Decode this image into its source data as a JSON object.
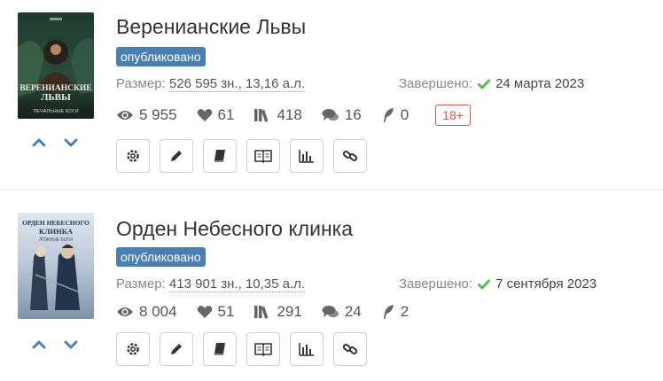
{
  "colors": {
    "accent": "#4a7fb2",
    "check": "#5cb85c",
    "age_badge": "#d9534f"
  },
  "books": [
    {
      "title": "Веренианские Львы",
      "status": "опубликовано",
      "size_label": "Размер:",
      "size_value": "526 595 зн., 13,16 а.л.",
      "finished_label": "Завершено:",
      "finished_date": "24 марта 2023",
      "stats": {
        "views": "5 955",
        "likes": "61",
        "library": "418",
        "comments": "16",
        "rewards": "0"
      },
      "age_rating": "18+",
      "cover": {
        "title_line1": "ВЕРЕНИАНСКИЕ",
        "title_line2": "ЛЬВЫ",
        "author": "ПЕЧАЛЬНЫЕ БОГИ"
      }
    },
    {
      "title": "Орден Небесного клинка",
      "status": "опубликовано",
      "size_label": "Размер:",
      "size_value": "413 901 зн., 10,35 а.л.",
      "finished_label": "Завершено:",
      "finished_date": "7 сентября 2023",
      "stats": {
        "views": "8 004",
        "likes": "51",
        "library": "291",
        "comments": "24",
        "rewards": "2"
      },
      "cover": {
        "title_line1": "ОРДЕН НЕБЕСНОГО",
        "title_line2": "КЛИНКА",
        "author": "ЛОЖНЫЕ БОГИ"
      }
    }
  ],
  "icons": {
    "vote_up": "chevron-up-icon",
    "vote_down": "chevron-down-icon",
    "views": "eye-icon",
    "likes": "heart-icon",
    "library": "books-icon",
    "comments": "comments-icon",
    "rewards": "feather-icon",
    "actions": [
      "gear-icon",
      "pencil-icon",
      "book-icon",
      "open-book-icon",
      "bar-chart-icon",
      "link-icon"
    ]
  }
}
